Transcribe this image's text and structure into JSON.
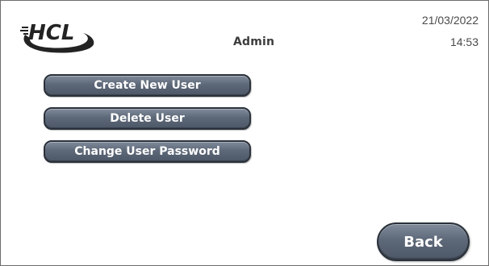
{
  "header": {
    "logo_text": "HCL",
    "user": "Admin",
    "date": "21/03/2022",
    "time": "14:53"
  },
  "menu": {
    "items": [
      {
        "label": "Create New User"
      },
      {
        "label": "Delete User"
      },
      {
        "label": "Change User Password"
      }
    ]
  },
  "footer": {
    "back_label": "Back"
  },
  "colors": {
    "button_fill": "#5d6878",
    "button_border": "#2b313a",
    "button_text": "#ffffff",
    "text": "#3c3c3c"
  }
}
